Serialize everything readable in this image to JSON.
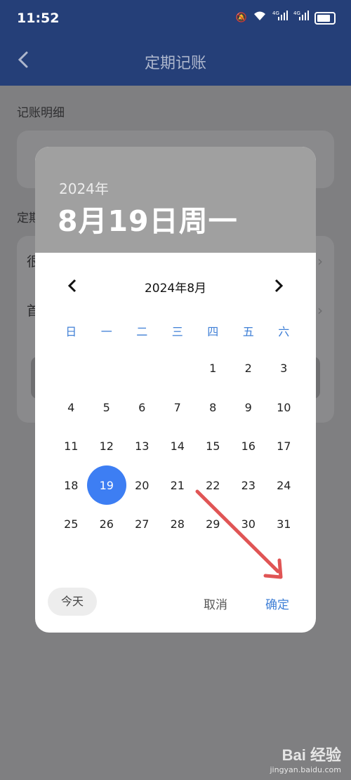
{
  "status_bar": {
    "time": "11:52",
    "network1": "4G",
    "network2": "4G"
  },
  "nav": {
    "title": "定期记账"
  },
  "background": {
    "section1": "记账明细",
    "section2": "定期",
    "row1": "很",
    "row2": "首"
  },
  "dialog": {
    "header": {
      "year": "2024年",
      "date": "8月19日周一"
    },
    "month_label": "2024年8月",
    "weekdays": [
      "日",
      "一",
      "二",
      "三",
      "四",
      "五",
      "六"
    ],
    "days": [
      "",
      "",
      "",
      "",
      "1",
      "2",
      "3",
      "4",
      "5",
      "6",
      "7",
      "8",
      "9",
      "10",
      "11",
      "12",
      "13",
      "14",
      "15",
      "16",
      "17",
      "18",
      "19",
      "20",
      "21",
      "22",
      "23",
      "24",
      "25",
      "26",
      "27",
      "28",
      "29",
      "30",
      "31"
    ],
    "selected_day": "19",
    "today_label": "今天",
    "cancel_label": "取消",
    "confirm_label": "确定"
  },
  "watermark": {
    "logo": "Bai 经验",
    "url": "jingyan.baidu.com"
  },
  "colors": {
    "accent": "#3d7ef3",
    "header": "#253f78",
    "annotation": "#e05555"
  }
}
